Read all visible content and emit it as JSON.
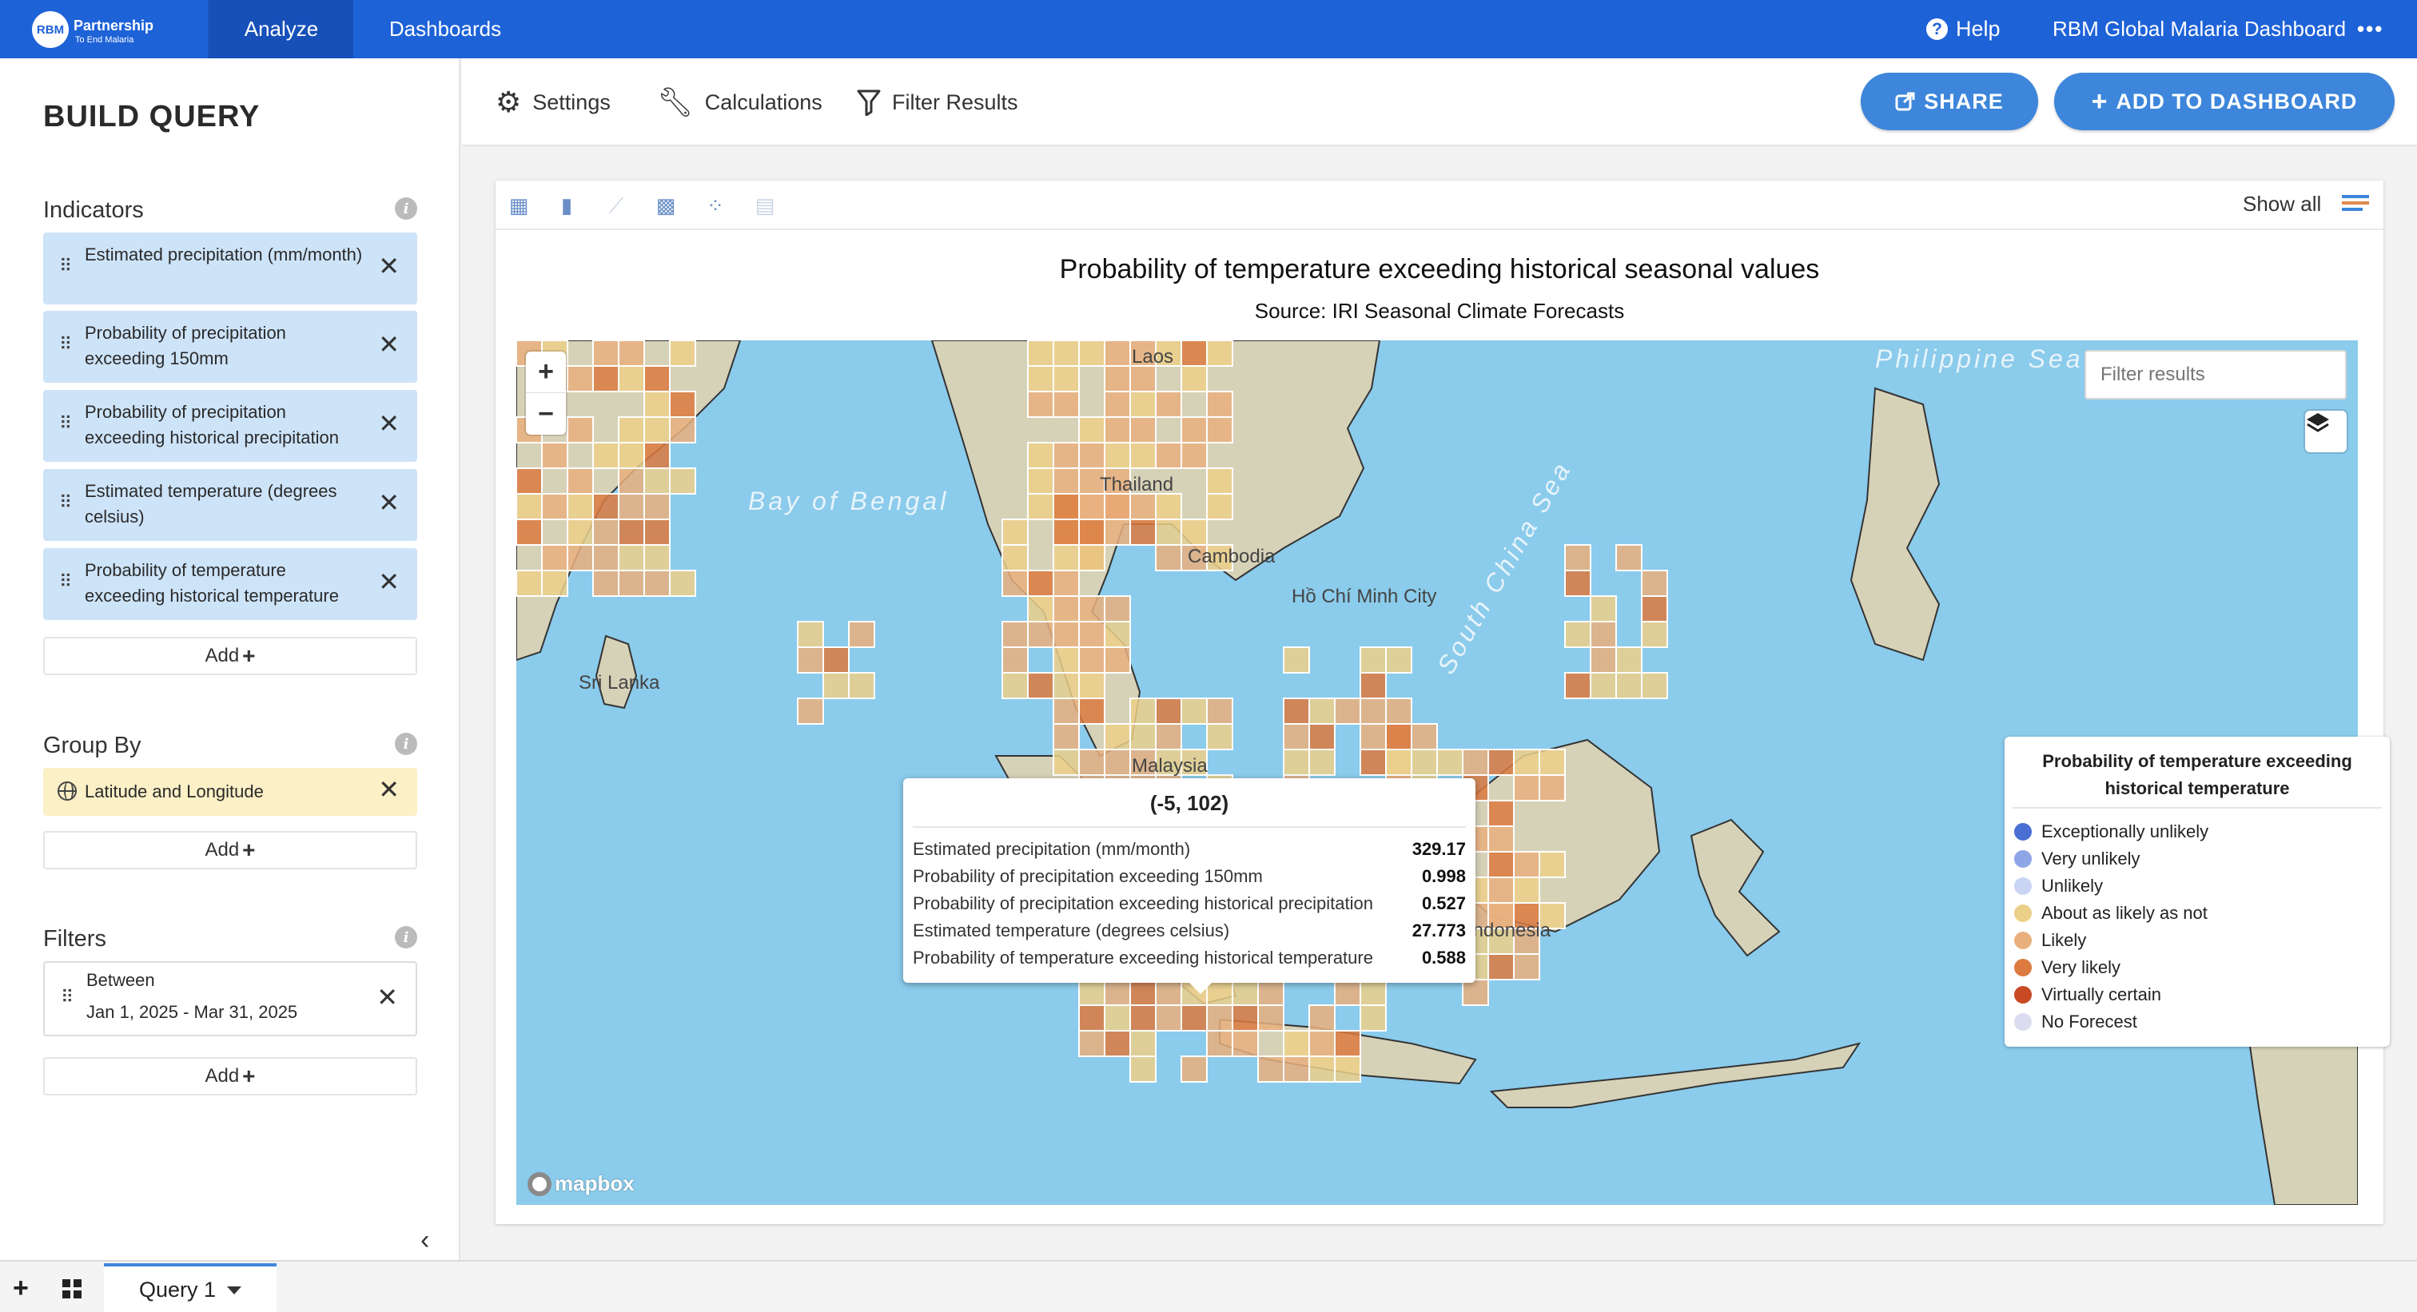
{
  "topbar": {
    "logo_line1": "RBM",
    "logo_line2": "Partnership",
    "logo_line3": "To End Malaria",
    "nav": [
      "Analyze",
      "Dashboards"
    ],
    "help_label": "Help",
    "app_title": "RBM Global Malaria Dashboard",
    "accent_color": "#1e62d8"
  },
  "sidebar": {
    "title": "BUILD QUERY",
    "indicators_title": "Indicators",
    "indicators": [
      "Estimated precipitation (mm/month)",
      "Probability of precipitation exceeding 150mm",
      "Probability of precipitation exceeding historical precipitation",
      "Estimated temperature (degrees celsius)",
      "Probability of temperature exceeding historical temperature"
    ],
    "groupby_title": "Group By",
    "groupby": [
      "Latitude and Longitude"
    ],
    "filters_title": "Filters",
    "filter": {
      "line1": "Between",
      "line2": "Jan 1, 2025 - Mar 31, 2025"
    },
    "add_label": "Add"
  },
  "toolbar": {
    "settings": "Settings",
    "calculations": "Calculations",
    "filter_results": "Filter Results",
    "share": "SHARE",
    "add_to_dashboard": "ADD TO DASHBOARD"
  },
  "viz": {
    "show_all": "Show all",
    "title": "Probability of temperature exceeding historical seasonal values",
    "subtitle": "Source: IRI Seasonal Climate Forecasts",
    "filter_placeholder": "Filter results",
    "map_labels": {
      "bay": "Bay of Bengal",
      "philippine_sea": "Philippine Sea",
      "south_china_sea": "South China Sea",
      "laos": "Laos",
      "thailand": "Thailand",
      "cambodia": "Cambodia",
      "sri_lanka": "Sri Lanka",
      "hcm": "Hồ Chí Minh City",
      "malaysia": "Malaysia",
      "indonesia": "Indonesia"
    },
    "mapbox": "mapbox"
  },
  "tooltip": {
    "title": "(-5, 102)",
    "rows": [
      {
        "label": "Estimated precipitation (mm/month)",
        "value": "329.17"
      },
      {
        "label": "Probability of precipitation exceeding 150mm",
        "value": "0.998"
      },
      {
        "label": "Probability of precipitation exceeding historical precipitation",
        "value": "0.527"
      },
      {
        "label": "Estimated temperature (degrees celsius)",
        "value": "27.773"
      },
      {
        "label": "Probability of temperature exceeding historical temperature",
        "value": "0.588"
      }
    ]
  },
  "legend": {
    "title": "Probability of temperature exceeding historical temperature",
    "items": [
      {
        "label": "Exceptionally unlikely",
        "color": "#4a6fd3"
      },
      {
        "label": "Very unlikely",
        "color": "#8ea6e6"
      },
      {
        "label": "Unlikely",
        "color": "#c9d5f2"
      },
      {
        "label": "About as likely as not",
        "color": "#ecd08a"
      },
      {
        "label": "Likely",
        "color": "#e9b07e"
      },
      {
        "label": "Very likely",
        "color": "#dc7a3f"
      },
      {
        "label": "Virtually certain",
        "color": "#c84a25"
      },
      {
        "label": "No Forecest",
        "color": "#dcdcf0"
      }
    ]
  },
  "bottombar": {
    "query_tab": "Query 1"
  }
}
